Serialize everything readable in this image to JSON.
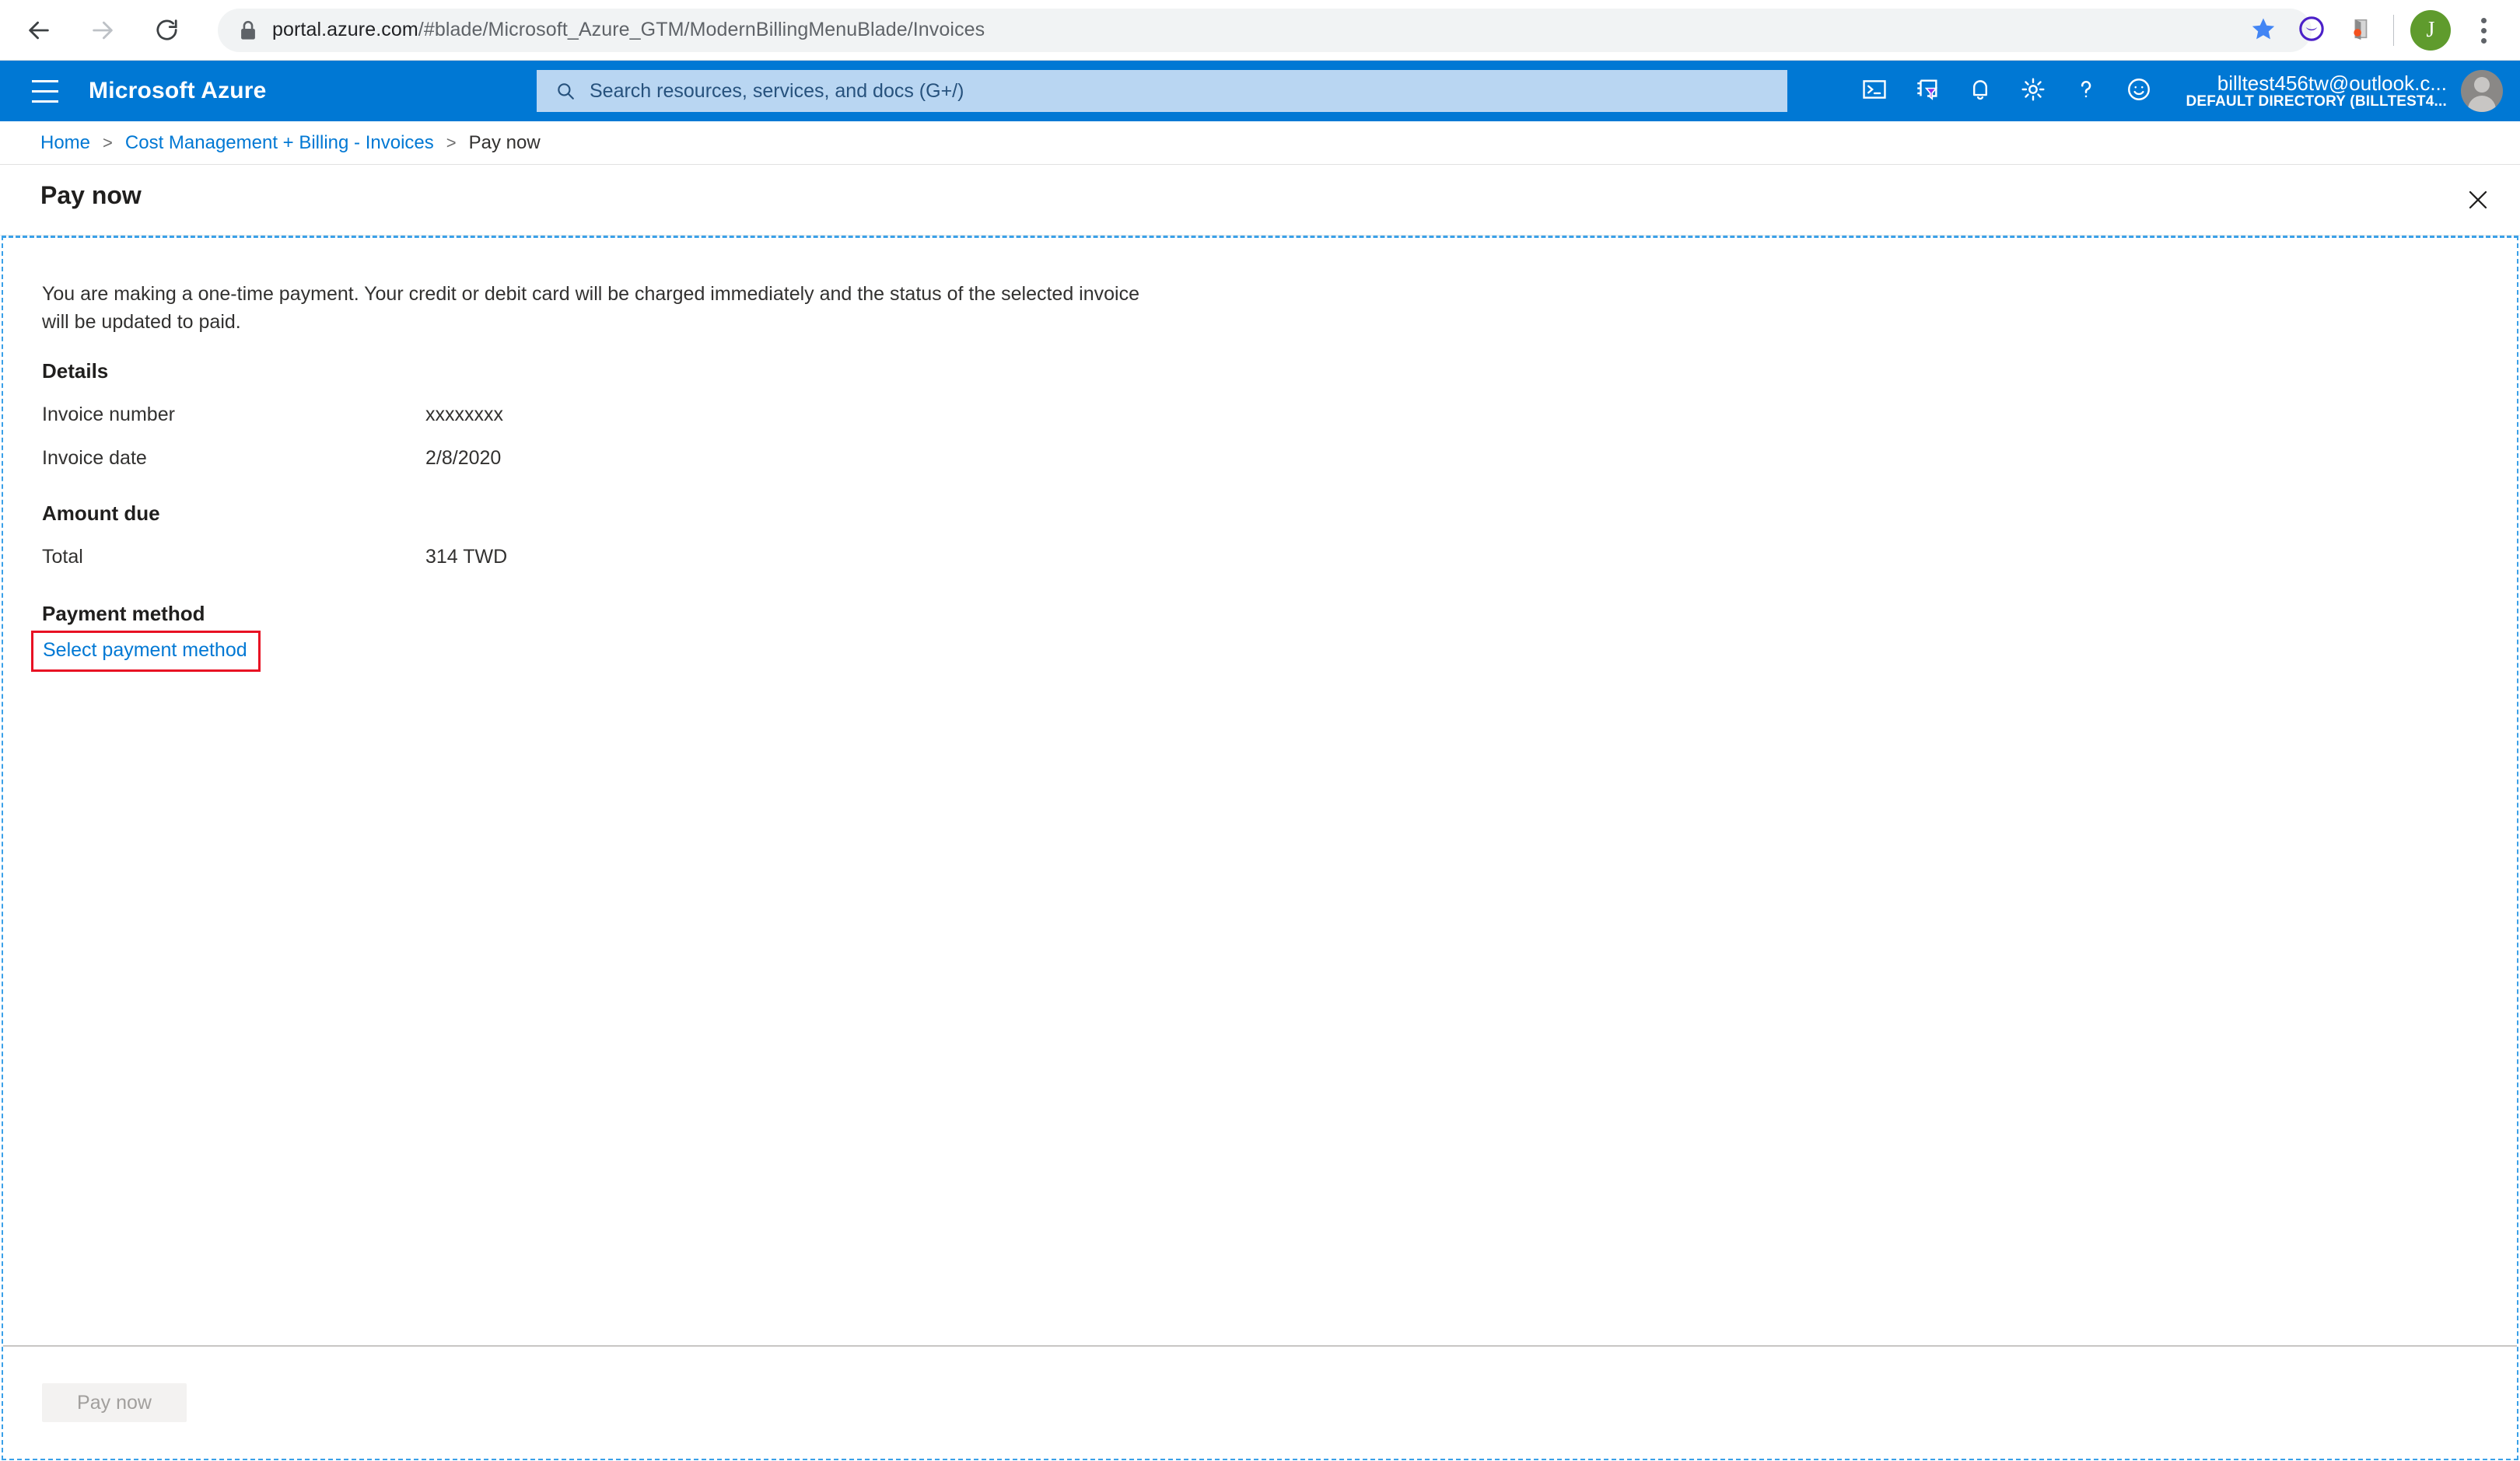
{
  "browser": {
    "back_icon": "arrow-left-icon",
    "forward_icon": "arrow-right-icon",
    "reload_icon": "reload-icon",
    "lock_icon": "lock-icon",
    "url_host": "portal.azure.com",
    "url_path": "/#blade/Microsoft_Azure_GTM/ModernBillingMenuBlade/Invoices",
    "bookmark_icon": "star-icon",
    "extension1_icon": "crescent-extension-icon",
    "extension2_icon": "pocket-extension-icon",
    "profile_initial": "J",
    "menu_icon": "kebab-menu-icon"
  },
  "azure_header": {
    "menu_icon": "hamburger-menu-icon",
    "brand": "Microsoft Azure",
    "search": {
      "icon": "search-icon",
      "placeholder": "Search resources, services, and docs (G+/)"
    },
    "icons": [
      {
        "name": "cloud-shell-icon"
      },
      {
        "name": "directory-filter-icon"
      },
      {
        "name": "notifications-bell-icon"
      },
      {
        "name": "settings-gear-icon"
      },
      {
        "name": "help-question-icon"
      },
      {
        "name": "feedback-smiley-icon"
      }
    ],
    "account": {
      "email": "billtest456tw@outlook.c...",
      "directory": "DEFAULT DIRECTORY (BILLTEST4...",
      "avatar": "user-avatar-icon"
    }
  },
  "breadcrumb": {
    "items": [
      {
        "label": "Home",
        "current": false
      },
      {
        "label": "Cost Management + Billing - Invoices",
        "current": false
      },
      {
        "label": "Pay now",
        "current": true
      }
    ],
    "separator": ">"
  },
  "blade": {
    "title": "Pay now",
    "close_icon": "close-x-icon"
  },
  "main": {
    "description": "You are making a one-time payment. Your credit or debit card will be charged immediately and the status of the selected invoice will be updated to paid.",
    "details": {
      "heading": "Details",
      "rows": [
        {
          "label": "Invoice number",
          "value": "xxxxxxxx"
        },
        {
          "label": "Invoice date",
          "value": "2/8/2020"
        }
      ]
    },
    "amount_due": {
      "heading": "Amount due",
      "rows": [
        {
          "label": "Total",
          "value": "314 TWD"
        }
      ]
    },
    "payment_method": {
      "heading": "Payment method",
      "link_label": "Select payment method",
      "highlight_color": "#e81123"
    }
  },
  "footer": {
    "pay_now_label": "Pay now"
  },
  "colors": {
    "azure_blue": "#0078d4",
    "link_blue": "#0078d4",
    "dashed_border": "#3aa0e8",
    "highlight_red": "#e81123",
    "disabled_button_bg": "#f3f2f1",
    "disabled_button_text": "#a19f9d"
  }
}
